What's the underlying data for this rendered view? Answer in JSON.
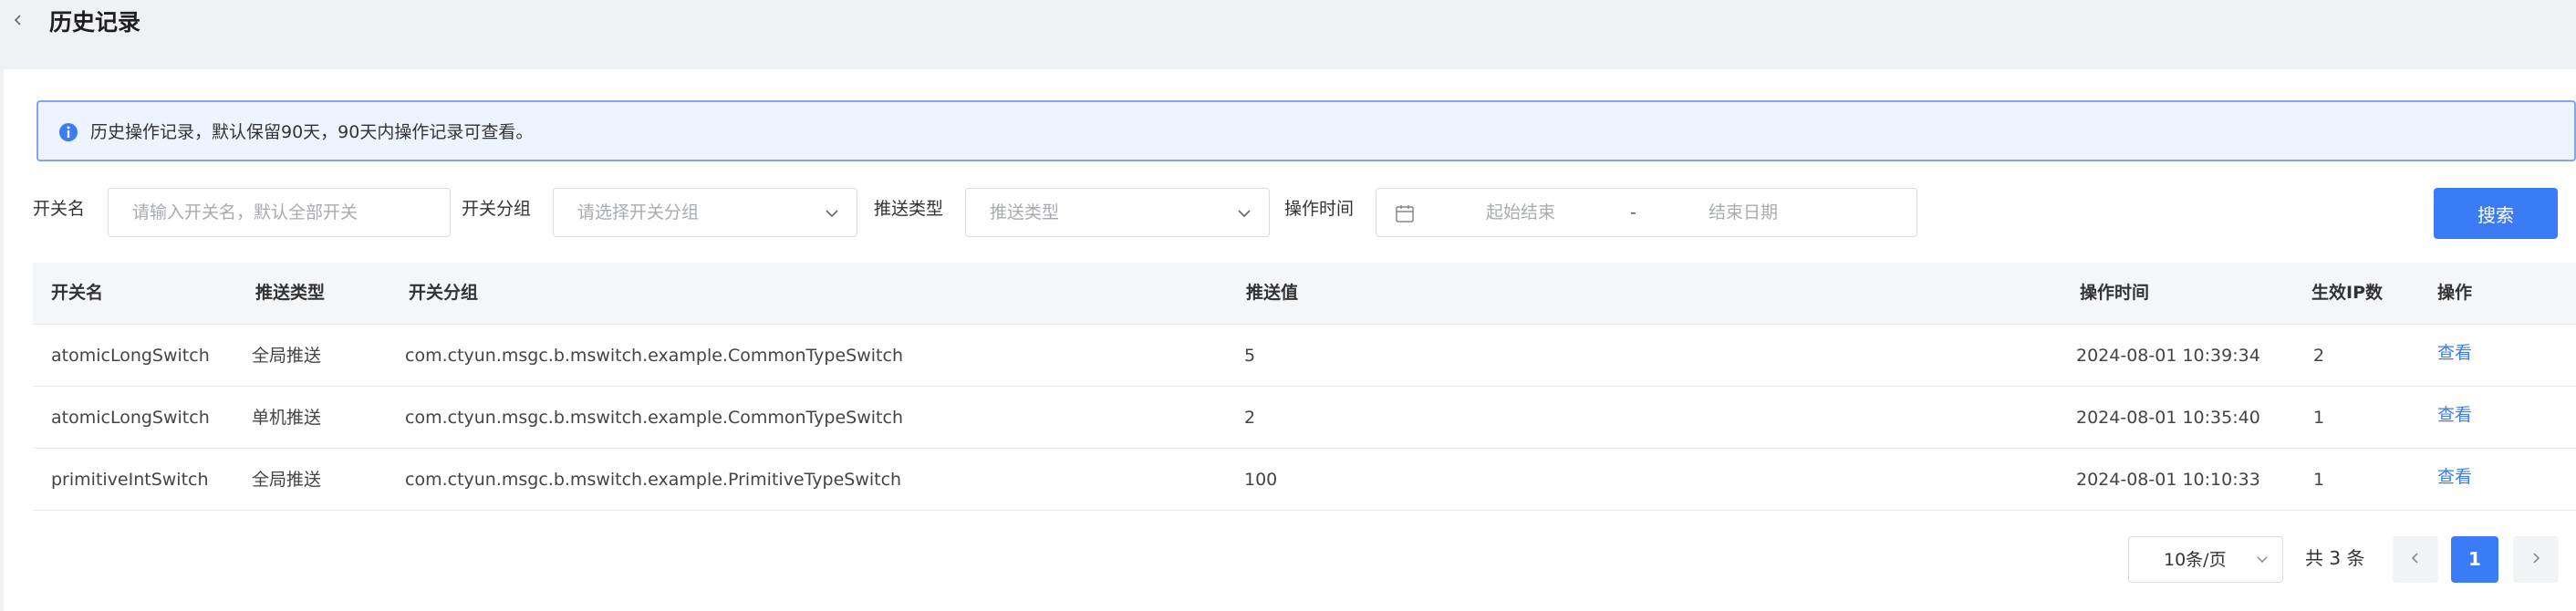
{
  "header": {
    "title": "历史记录"
  },
  "alert": {
    "text": "历史操作记录，默认保留90天，90天内操作记录可查看。"
  },
  "filters": {
    "switch_name_label": "开关名",
    "switch_name_placeholder": "请输入开关名，默认全部开关",
    "group_label": "开关分组",
    "group_placeholder": "请选择开关分组",
    "push_type_label": "推送类型",
    "push_type_placeholder": "推送类型",
    "time_label": "操作时间",
    "start_placeholder": "起始结束",
    "separator": "-",
    "end_placeholder": "结束日期",
    "search_label": "搜索"
  },
  "table": {
    "headers": [
      "开关名",
      "推送类型",
      "开关分组",
      "推送值",
      "操作时间",
      "生效IP数",
      "操作"
    ],
    "rows": [
      {
        "name": "atomicLongSwitch",
        "push_type": "全局推送",
        "group": "com.ctyun.msgc.b.mswitch.example.CommonTypeSwitch",
        "value": "5",
        "time": "2024-08-01 10:39:34",
        "ip_count": "2",
        "action": "查看"
      },
      {
        "name": "atomicLongSwitch",
        "push_type": "单机推送",
        "group": "com.ctyun.msgc.b.mswitch.example.CommonTypeSwitch",
        "value": "2",
        "time": "2024-08-01 10:35:40",
        "ip_count": "1",
        "action": "查看"
      },
      {
        "name": "primitiveIntSwitch",
        "push_type": "全局推送",
        "group": "com.ctyun.msgc.b.mswitch.example.PrimitiveTypeSwitch",
        "value": "100",
        "time": "2024-08-01 10:10:33",
        "ip_count": "1",
        "action": "查看"
      }
    ]
  },
  "pagination": {
    "page_size": "10条/页",
    "total": "共 3 条",
    "current_page": "1"
  },
  "colors": {
    "accent": "#3b7cf4",
    "alert_bg": "#eef4ff",
    "alert_border": "#7fa5f3",
    "page_bg": "#f0f1f4"
  }
}
